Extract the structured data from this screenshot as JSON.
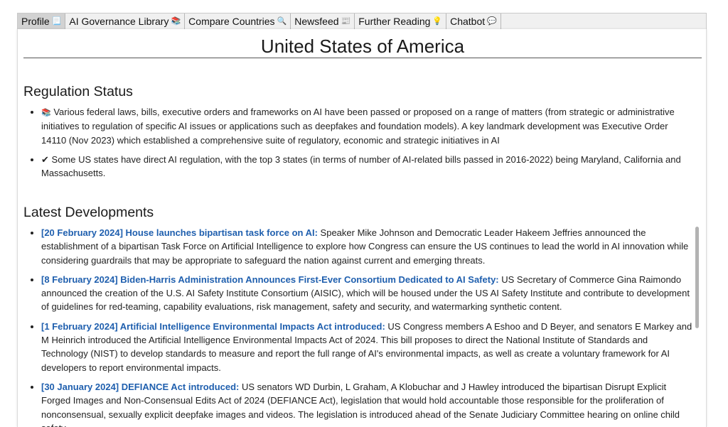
{
  "tabs": [
    {
      "label": "Profile",
      "icon": "📃",
      "icon_name": "page-icon",
      "active": true
    },
    {
      "label": "AI Governance Library",
      "icon": "📚",
      "icon_name": "books-icon",
      "active": false
    },
    {
      "label": "Compare Countries",
      "icon": "🔍",
      "icon_name": "magnifier-icon",
      "active": false
    },
    {
      "label": "Newsfeed",
      "icon": "📰",
      "icon_name": "newspaper-icon",
      "active": false
    },
    {
      "label": "Further Reading",
      "icon": "💡",
      "icon_name": "lightbulb-icon",
      "active": false
    },
    {
      "label": "Chatbot",
      "icon": "💬",
      "icon_name": "speech-bubble-icon",
      "active": false
    }
  ],
  "page": {
    "title": "United States of America"
  },
  "regulation": {
    "heading": "Regulation Status",
    "items": [
      {
        "icon": "📚",
        "icon_name": "books-icon",
        "text": "Various federal laws, bills, executive orders and frameworks on AI have been passed or proposed on a range of matters (from strategic or administrative initiatives to regulation of specific AI issues or applications such as deepfakes and foundation models). A key landmark development was Executive Order 14110 (Nov 2023) which established a comprehensive suite of regulatory, economic and strategic initiatives in AI"
      },
      {
        "icon": "✔",
        "icon_name": "checkmark-icon",
        "text": "Some US states have direct AI regulation, with the top 3 states (in terms of number of AI-related bills passed in 2016-2022) being Maryland, California and Massachusetts."
      }
    ]
  },
  "developments": {
    "heading": "Latest Developments",
    "items": [
      {
        "link": "[20 February 2024] House launches bipartisan task force on AI:",
        "text": "Speaker Mike Johnson and Democratic Leader Hakeem Jeffries announced the establishment of a bipartisan Task Force on Artificial Intelligence to explore how Congress can ensure the US continues to lead the world in AI innovation while considering guardrails that may be appropriate to safeguard the nation against current and emerging threats."
      },
      {
        "link": "[8 February 2024] Biden-Harris Administration Announces First-Ever Consortium Dedicated to AI Safety:",
        "text": "US Secretary of Commerce Gina Raimondo announced the creation of the U.S. AI Safety Institute Consortium (AISIC), which will be housed under the US AI Safety Institute and contribute to development of guidelines for red-teaming, capability evaluations, risk management, safety and security, and watermarking synthetic content."
      },
      {
        "link": "[1 February 2024] Artificial Intelligence Environmental Impacts Act introduced:",
        "text": "US Congress members A Eshoo and D Beyer, and senators E Markey and M Heinrich introduced the Artificial Intelligence Environmental Impacts Act of 2024. This bill proposes to direct the National Institute of Standards and Technology (NIST) to develop standards to measure and report the full range of AI's environmental impacts, as well as create a voluntary framework for AI developers to report environmental impacts."
      },
      {
        "link": "[30 January 2024] DEFIANCE Act introduced:",
        "text": "US senators WD Durbin, L Graham, A Klobuchar and J Hawley introduced the bipartisan Disrupt Explicit Forged Images and Non-Consensual Edits Act of 2024 (DEFIANCE Act), legislation that would hold accountable those responsible for the proliferation of nonconsensual, sexually explicit deepfake images and videos. The legislation is introduced ahead of the Senate Judiciary Committee hearing on online child safety."
      }
    ]
  },
  "colors": {
    "link": "#1f5fae",
    "active_tab": "#d2d2d2",
    "tabbar": "#f0f0f0"
  }
}
